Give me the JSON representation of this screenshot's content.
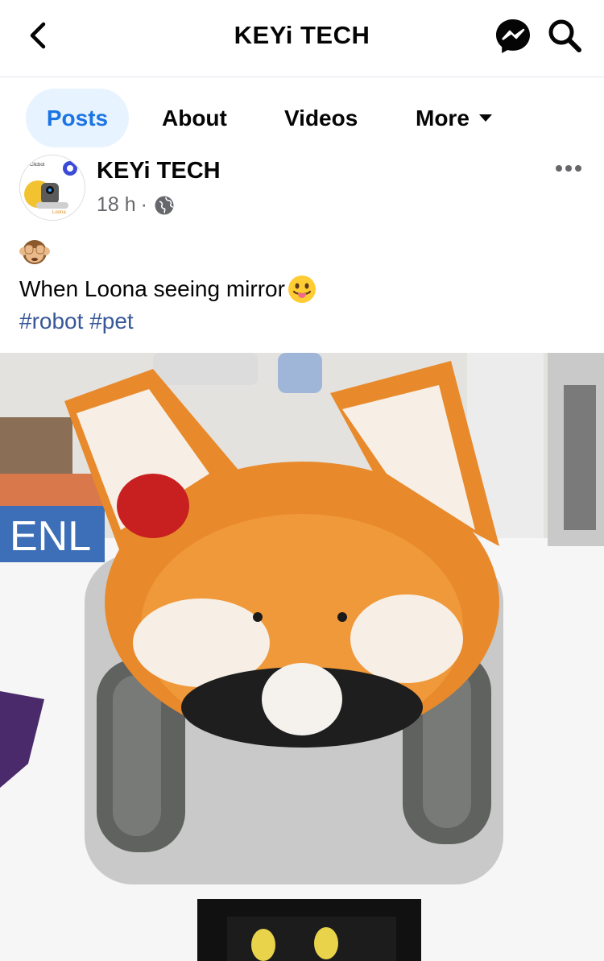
{
  "header": {
    "title": "KEYi TECH",
    "icons": [
      "back-arrow-icon",
      "messenger-icon",
      "search-icon"
    ]
  },
  "tabs": [
    {
      "label": "Posts",
      "active": true
    },
    {
      "label": "About"
    },
    {
      "label": "Videos"
    },
    {
      "label": "More"
    }
  ],
  "post": {
    "author": "KEYi TECH",
    "time": "18 h",
    "separator": "·",
    "emoji_line": "🙈",
    "text": "When Loona seeing mirror",
    "text_emoji": "😛",
    "hashtags": [
      "#robot",
      "#pet"
    ],
    "avatar_text_top": "Clicbot",
    "avatar_text_bottom": "Loona"
  },
  "colors": {
    "accent": "#1b74e4",
    "active_tab_bg": "#e7f3ff",
    "hashtag": "#385898",
    "secondary_text": "#65676b"
  },
  "photo": {
    "description_sign": "ENL"
  }
}
